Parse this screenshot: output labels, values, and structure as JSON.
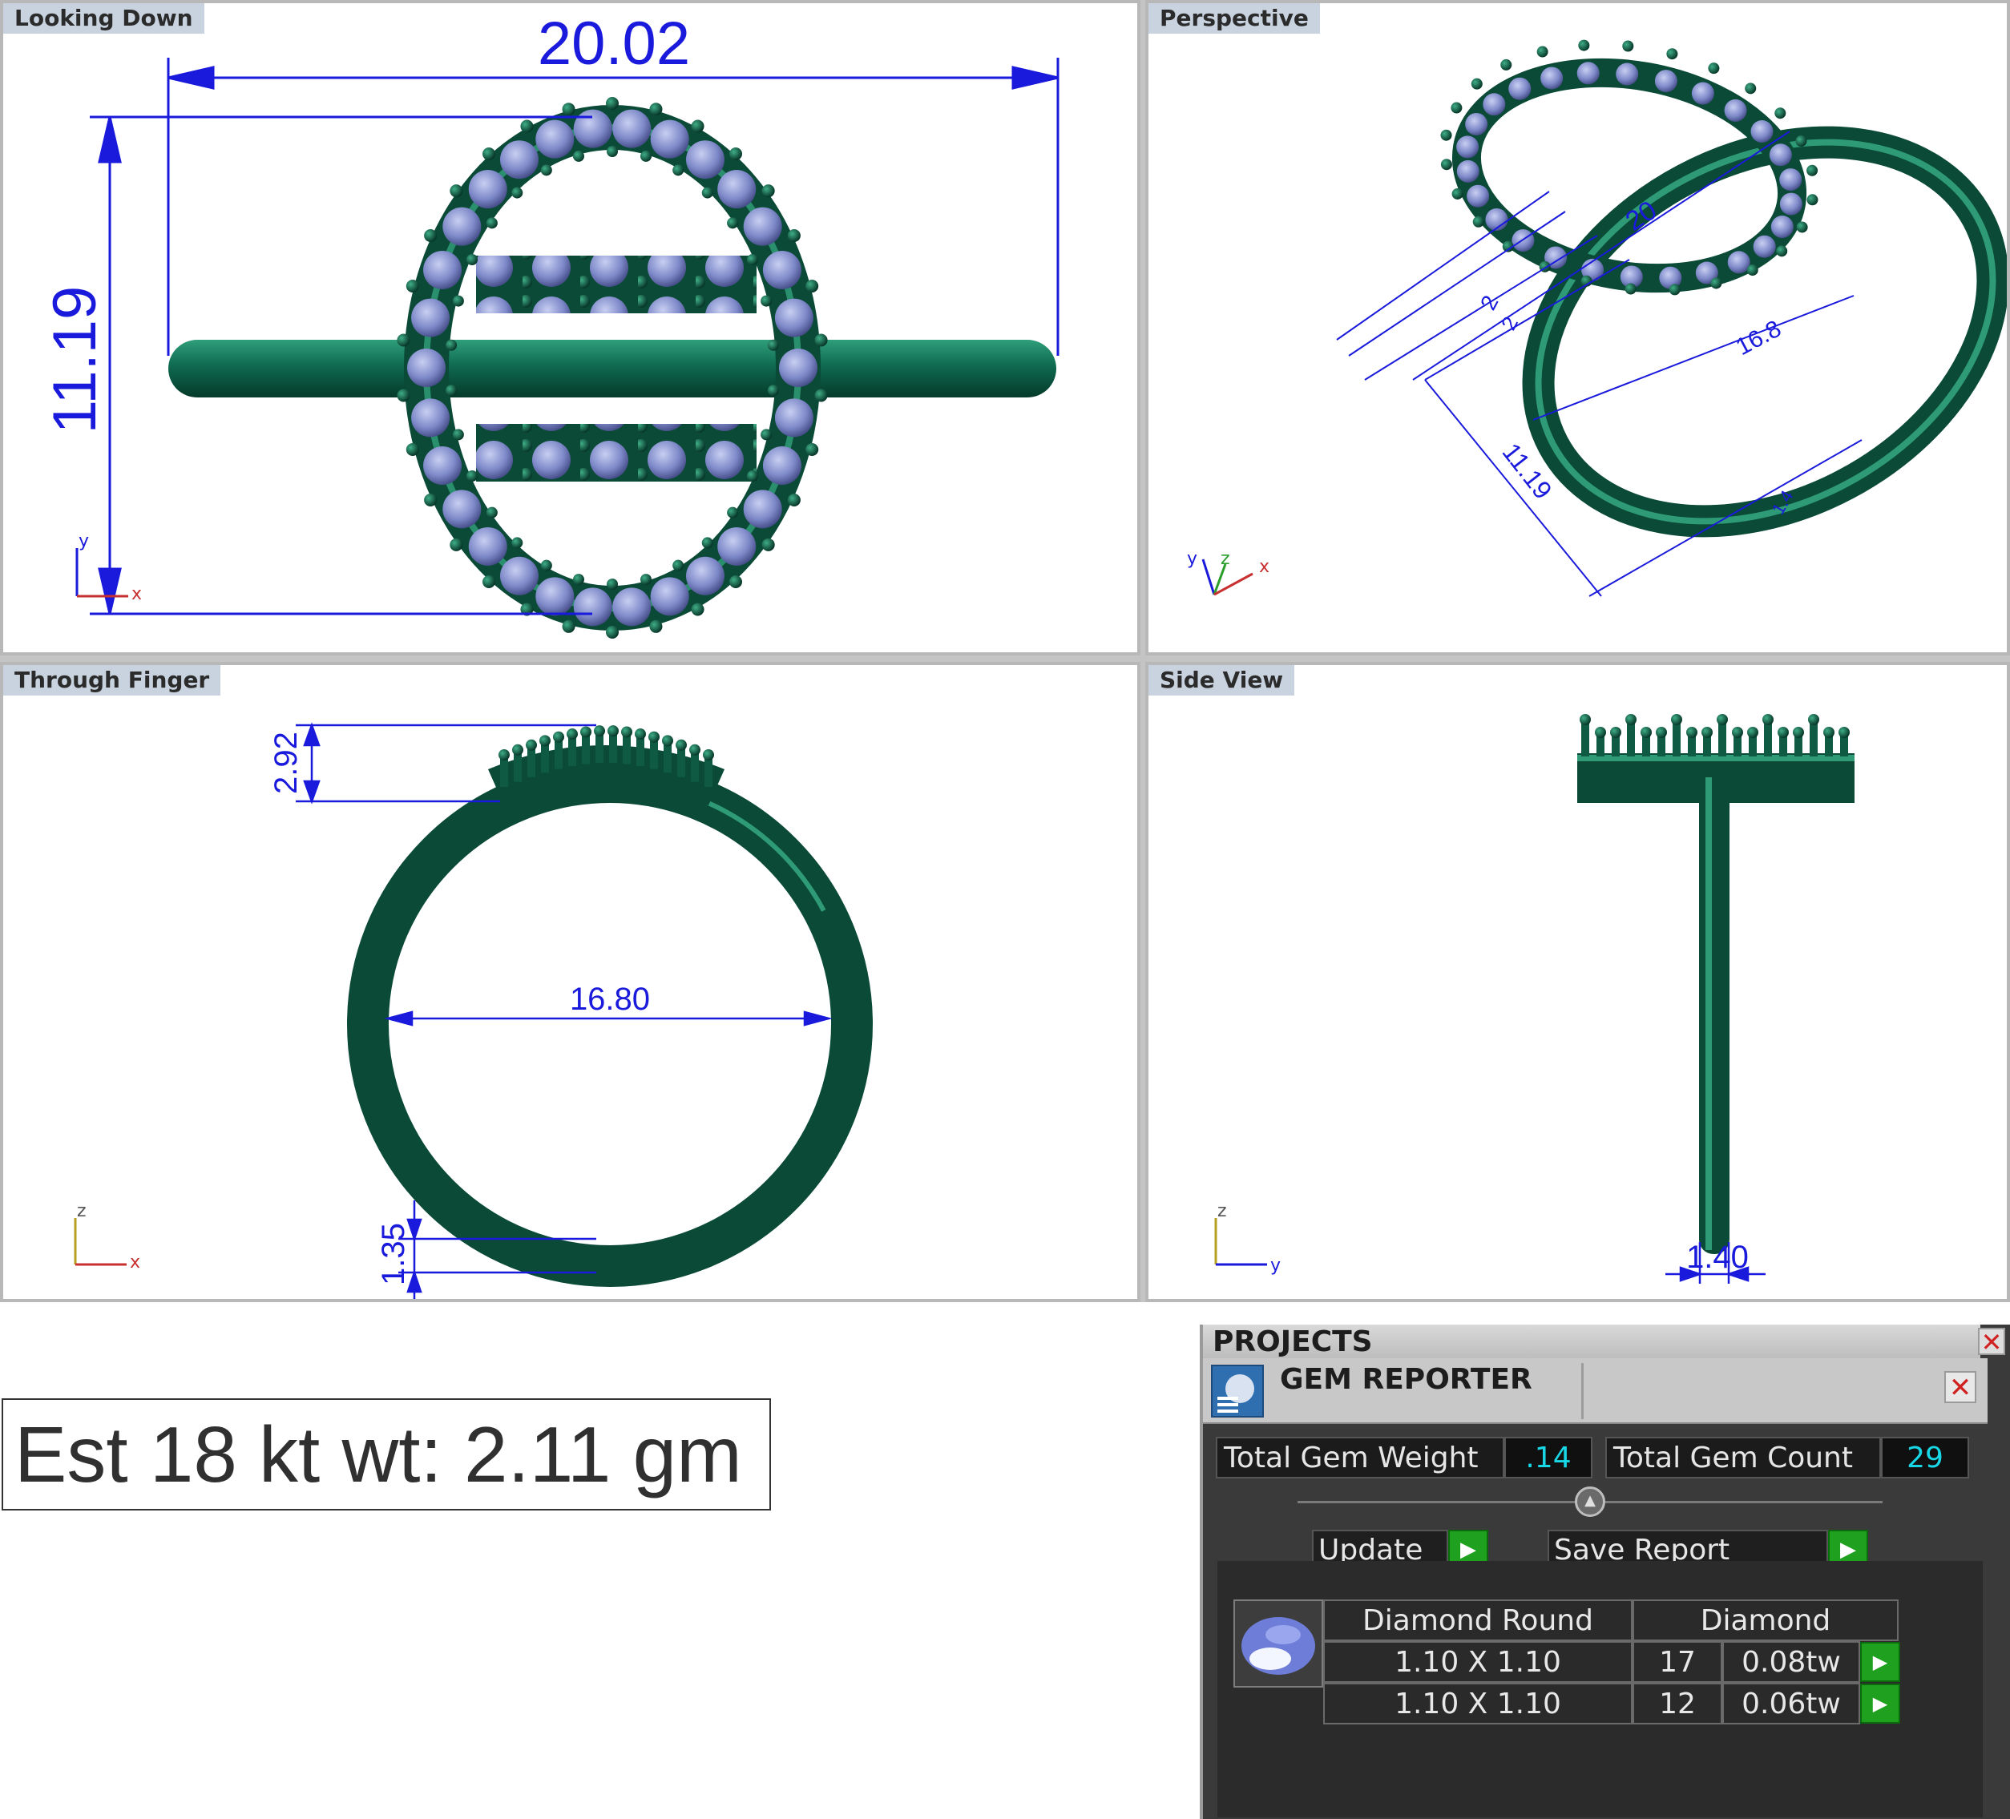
{
  "viewports": {
    "top_left": {
      "title": "Looking Down",
      "dims": {
        "width": "20.02",
        "height": "11.19"
      },
      "axes": [
        "y",
        "x"
      ]
    },
    "top_right": {
      "title": "Perspective",
      "dims": {
        "a": "20",
        "b": "16.8",
        "c": "11.19",
        "d": "2",
        "e": "2",
        "f": "1.4"
      },
      "axes": [
        "y",
        "z",
        "x"
      ]
    },
    "bottom_left": {
      "title": "Through Finger",
      "dims": {
        "top": "2.92",
        "inner": "16.80",
        "bottom": "1.35"
      },
      "axes": [
        "z",
        "x"
      ]
    },
    "bottom_right": {
      "title": "Side View",
      "dims": {
        "shank": "1.40"
      },
      "axes": [
        "z",
        "y"
      ]
    }
  },
  "estimate": {
    "label": "Est 18 kt wt: 2.11 gm"
  },
  "panel": {
    "header": "PROJECTS",
    "tab_title": "GEM REPORTER",
    "total_weight_label": "Total Gem Weight",
    "total_weight_value": ".14",
    "total_count_label": "Total Gem Count",
    "total_count_value": "29",
    "update_label": "Update",
    "save_label": "Save Report",
    "table": {
      "headers": [
        "Diamond Round",
        "Diamond"
      ],
      "rows": [
        {
          "size": "1.10 X 1.10",
          "count": "17",
          "weight": "0.08tw"
        },
        {
          "size": "1.10 X 1.10",
          "count": "12",
          "weight": "0.06tw"
        }
      ]
    }
  },
  "colors": {
    "metal": "#0d5a44",
    "dimension": "#1a1adc",
    "gem": "#7d88c8",
    "panel_bg": "#3a3a3a",
    "accent_cyan": "#18d8e8",
    "go_green": "#1fa01f"
  }
}
